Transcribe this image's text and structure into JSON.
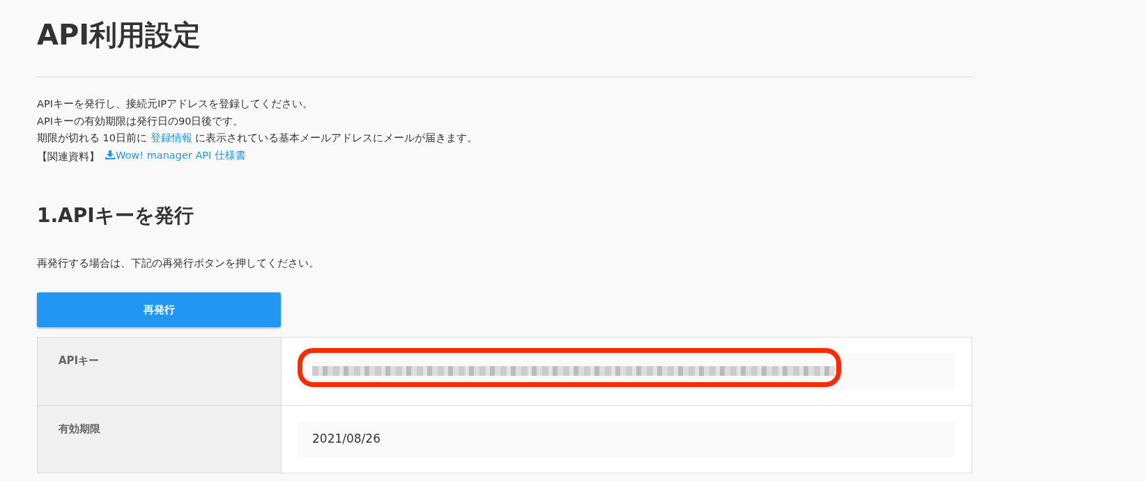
{
  "title": "API利用設定",
  "intro": [
    {
      "text": "APIキーを発行し、接続元IPアドレスを登録してください。"
    },
    {
      "text": "APIキーの有効期限は発行日の90日後です。"
    },
    {
      "parts": [
        "期限が切れる 10日前に ",
        "登録情報",
        " に表示されている基本メールアドレスにメールが届きます。"
      ]
    },
    {
      "label": "【関連資料】",
      "link": "Wow! manager API 仕様書"
    }
  ],
  "section": {
    "heading": "1.APIキーを発行",
    "note": "再発行する場合は、下記の再発行ボタンを押してください。",
    "button": "再発行"
  },
  "table": {
    "rows": [
      {
        "label": "APIキー",
        "kind": "redacted"
      },
      {
        "label": "有効期限",
        "kind": "text",
        "value": "2021/08/26"
      }
    ]
  }
}
